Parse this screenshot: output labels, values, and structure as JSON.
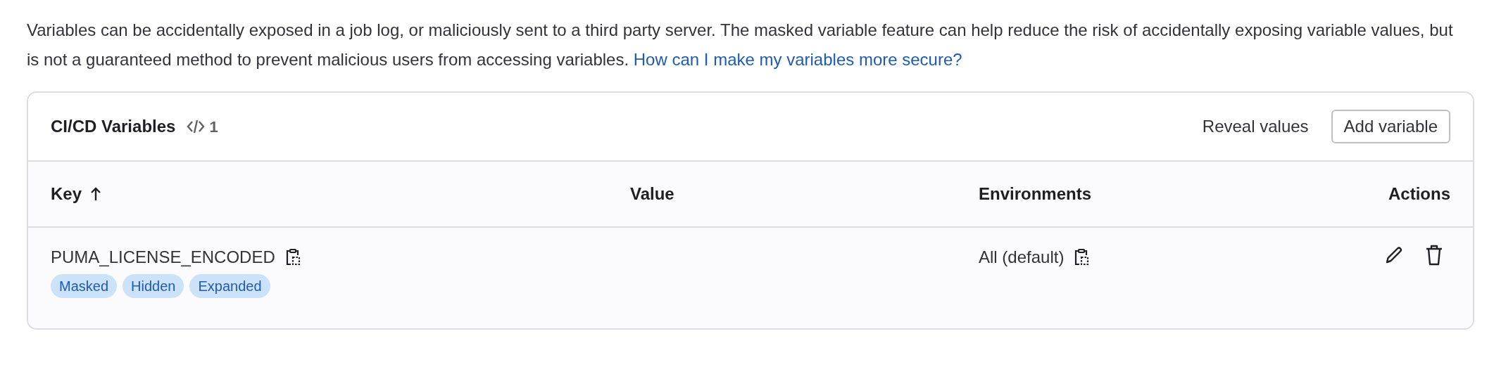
{
  "intro": {
    "text": "Variables can be accidentally exposed in a job log, or maliciously sent to a third party server. The masked variable feature can help reduce the risk of accidentally exposing variable values, but is not a guaranteed method to prevent malicious users from accessing variables.",
    "link": "How can I make my variables more secure?"
  },
  "card": {
    "title": "CI/CD Variables",
    "count": "1",
    "reveal_button": "Reveal values",
    "add_button": "Add variable"
  },
  "table": {
    "columns": [
      {
        "label": "Key",
        "sorted": true
      },
      {
        "label": "Value",
        "sorted": false
      },
      {
        "label": "Environments",
        "sorted": false
      },
      {
        "label": "Actions",
        "sorted": false
      }
    ],
    "rows": [
      {
        "key": "PUMA_LICENSE_ENCODED",
        "badges": [
          "Masked",
          "Hidden",
          "Expanded"
        ],
        "environment": "All (default)"
      }
    ]
  }
}
